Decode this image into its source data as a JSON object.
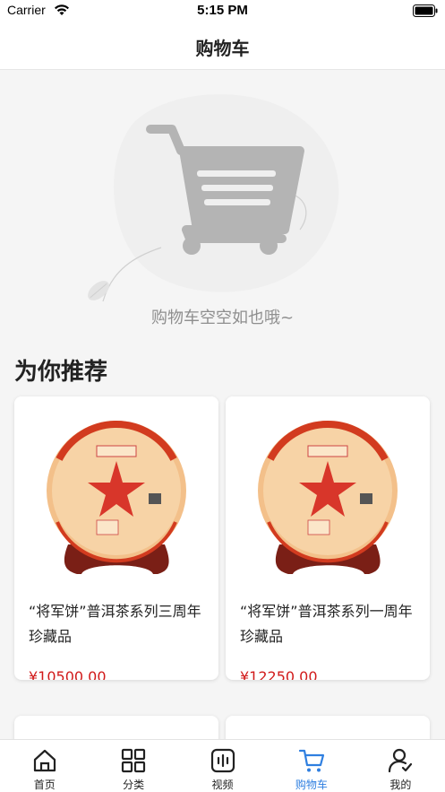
{
  "status": {
    "carrier": "Carrier",
    "time": "5:15 PM"
  },
  "nav": {
    "title": "购物车"
  },
  "empty": {
    "text": "购物车空空如也哦~"
  },
  "recommend": {
    "title": "为你推荐",
    "products": [
      {
        "name": "“将军饼”普洱茶系列三周年珍藏品",
        "price": "¥10500.00"
      },
      {
        "name": "“将军饼”普洱茶系列一周年珍藏品",
        "price": "¥12250.00"
      }
    ]
  },
  "tabs": [
    {
      "label": "首页",
      "icon": "home-icon"
    },
    {
      "label": "分类",
      "icon": "grid-icon"
    },
    {
      "label": "视频",
      "icon": "video-icon"
    },
    {
      "label": "购物车",
      "icon": "cart-icon",
      "active": true
    },
    {
      "label": "我的",
      "icon": "user-icon"
    }
  ],
  "colors": {
    "accent": "#2f7fe0",
    "price": "#d11a1a"
  }
}
